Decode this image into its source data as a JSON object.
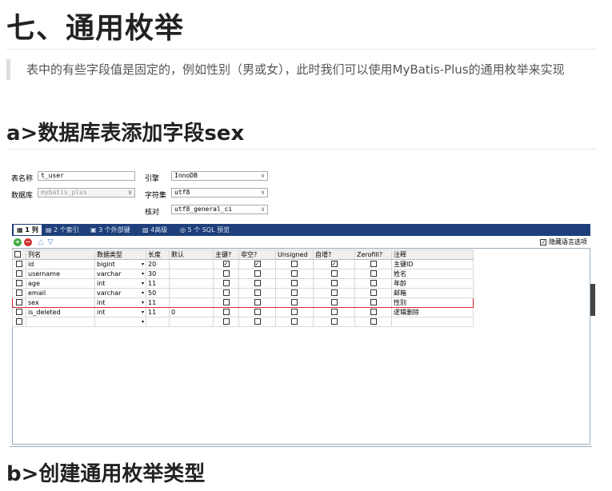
{
  "heading_main": "七、通用枚举",
  "quote_text": "表中的有些字段值是固定的，例如性别（男或女），此时我们可以使用MyBatis-Plus的通用枚举来实现",
  "heading_a": "a>数据库表添加字段sex",
  "heading_b": "b>创建通用枚举类型",
  "form": {
    "table_name_label": "表名称",
    "table_name_value": "t_user",
    "database_label": "数据库",
    "database_value": "mybatis_plus",
    "engine_label": "引擎",
    "engine_value": "InnoDB",
    "charset_label": "字符集",
    "charset_value": "utf8",
    "collation_label": "核对",
    "collation_value": "utf8_general_ci"
  },
  "tabs": [
    "1 列",
    "2 个索引",
    "3 个外部键",
    "4高级",
    "5 个 SQL 预览"
  ],
  "hide_language_option": "隐藏语言选项",
  "columns_header": [
    "列名",
    "数据类型",
    "长度",
    "默认",
    "主键?",
    "非空?",
    "Unsigned",
    "自增?",
    "Zerofill?",
    "注释"
  ],
  "rows": [
    {
      "name": "id",
      "type": "bigint",
      "length": "20",
      "default": "",
      "pk": true,
      "notnull": true,
      "unsigned": false,
      "auto": true,
      "zerofill": false,
      "comment": "主键ID"
    },
    {
      "name": "username",
      "type": "varchar",
      "length": "30",
      "default": "",
      "pk": false,
      "notnull": false,
      "unsigned": false,
      "auto": false,
      "zerofill": false,
      "comment": "姓名"
    },
    {
      "name": "age",
      "type": "int",
      "length": "11",
      "default": "",
      "pk": false,
      "notnull": false,
      "unsigned": false,
      "auto": false,
      "zerofill": false,
      "comment": "年龄"
    },
    {
      "name": "email",
      "type": "varchar",
      "length": "50",
      "default": "",
      "pk": false,
      "notnull": false,
      "unsigned": false,
      "auto": false,
      "zerofill": false,
      "comment": "邮箱"
    },
    {
      "name": "sex",
      "type": "int",
      "length": "11",
      "default": "",
      "pk": false,
      "notnull": false,
      "unsigned": false,
      "auto": false,
      "zerofill": false,
      "comment": "性别"
    },
    {
      "name": "is_deleted",
      "type": "int",
      "length": "11",
      "default": "0",
      "pk": false,
      "notnull": false,
      "unsigned": false,
      "auto": false,
      "zerofill": false,
      "comment": "逻辑删除"
    },
    {
      "name": "",
      "type": "",
      "length": "",
      "default": "",
      "pk": false,
      "notnull": false,
      "unsigned": false,
      "auto": false,
      "zerofill": false,
      "comment": ""
    }
  ],
  "highlight_row": "sex",
  "colors": {
    "tabbar": "#1e3f7a",
    "highlight": "#d22233",
    "add_button": "#3aa83a",
    "remove_button": "#d23030"
  }
}
